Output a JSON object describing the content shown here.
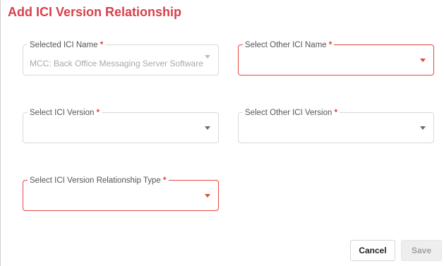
{
  "dialog": {
    "title": "Add ICI Version Relationship",
    "required_marker": "*"
  },
  "fields": {
    "selected_ici_name": {
      "label": "Selected ICI Name",
      "value": "MCC: Back Office Messaging Server Software",
      "disabled": true
    },
    "select_other_ici_name": {
      "label": "Select Other ICI Name",
      "value": "",
      "state": "error"
    },
    "select_ici_version": {
      "label": "Select ICI Version",
      "value": ""
    },
    "select_other_ici_version": {
      "label": "Select Other ICI Version",
      "value": ""
    },
    "select_relationship_type": {
      "label": "Select ICI Version Relationship Type",
      "value": "",
      "state": "error"
    }
  },
  "actions": {
    "cancel_label": "Cancel",
    "save_label": "Save",
    "save_disabled": true
  },
  "colors": {
    "title": "#d8404a",
    "error_border": "#e2473f",
    "required": "#e03d3d"
  }
}
